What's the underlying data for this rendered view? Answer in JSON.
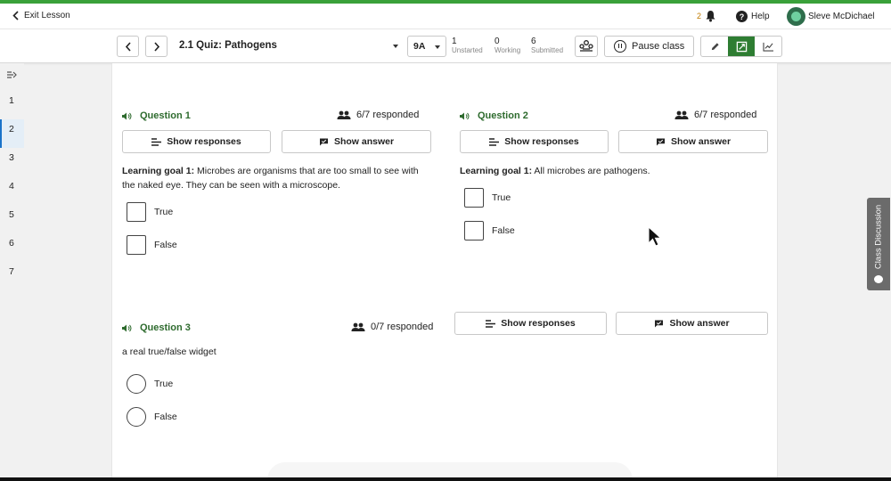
{
  "header": {
    "exit_label": "Exit Lesson",
    "notification_count": "2",
    "help_label": "Help",
    "user_name": "Sleve McDichael"
  },
  "toolbar": {
    "quiz_title": "2.1 Quiz: Pathogens",
    "class_name": "9A",
    "stats": [
      {
        "value": "1",
        "label": "Unstarted"
      },
      {
        "value": "0",
        "label": "Working"
      },
      {
        "value": "6",
        "label": "Submitted"
      }
    ],
    "pause_label": "Pause class"
  },
  "sidebar": {
    "items": [
      "1",
      "2",
      "3",
      "4",
      "5",
      "6",
      "7"
    ],
    "selected_index": 1
  },
  "questions": [
    {
      "title": "Question 1",
      "responded": "6/7 responded",
      "show_responses": "Show responses",
      "show_answer": "Show answer",
      "goal_label": "Learning goal 1:",
      "goal_text": " Microbes are organisms that are too small to see with the naked eye. They can be seen with a microscope.",
      "options": [
        "True",
        "False"
      ]
    },
    {
      "title": "Question 2",
      "responded": "6/7 responded",
      "show_responses": "Show responses",
      "show_answer": "Show answer",
      "goal_label": "Learning goal 1:",
      "goal_text": " All microbes are pathogens.",
      "options": [
        "True",
        "False"
      ]
    },
    {
      "title": "Question 3",
      "responded": "0/7 responded",
      "show_responses": "Show responses",
      "show_answer": "Show answer",
      "prompt": "a real true/false widget",
      "options": [
        "True",
        "False"
      ]
    }
  ],
  "discussion_label": "Class Discussion",
  "colors": {
    "accent_green": "#2e7d32",
    "question_title": "#2e6b2e",
    "selected_rail": "#1a73c9"
  }
}
